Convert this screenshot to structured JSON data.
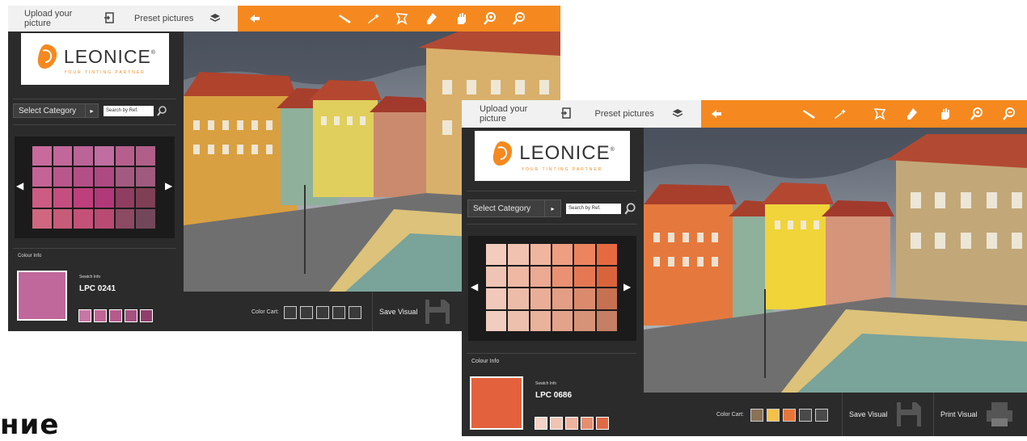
{
  "page": {
    "heading_fragment": "ние"
  },
  "toolbar": {
    "upload_label": "Upload your picture",
    "preset_label": "Preset pictures"
  },
  "brand": {
    "name": "LEONICE",
    "reg": "®",
    "tagline": "YOUR TINTING PARTNER"
  },
  "category": {
    "select_label": "Select Category",
    "search_placeholder": "Search by Ref."
  },
  "colour_info": {
    "section_label": "Colour Info",
    "swatch_info_label": "Swatch Info"
  },
  "bottom": {
    "color_cart_label": "Color Cart:",
    "save_label": "Save Visual",
    "print_label": "Print Visual"
  },
  "window1": {
    "swatch_code": "LPC 0241",
    "selected_color": "#c0679b",
    "palette": [
      [
        "#c86a9c",
        "#c2679a",
        "#bb6497",
        "#c06ea1",
        "#b65f8d",
        "#b05f89"
      ],
      [
        "#c46395",
        "#b9578a",
        "#b44f86",
        "#ad4a82",
        "#a45a80",
        "#9f5a7d"
      ],
      [
        "#cc5c84",
        "#c44e80",
        "#bd3f7b",
        "#b1397a",
        "#8f3e61",
        "#7f4056"
      ],
      [
        "#cf6780",
        "#c65c7a",
        "#c45177",
        "#b94b72",
        "#8c4a63",
        "#73475a"
      ]
    ],
    "mini_swatches": [
      "#c877a5",
      "#c06595",
      "#b55a8c",
      "#a55181",
      "#8e3f6c"
    ],
    "cart": [
      "#3a3a3a",
      "#3a3a3a",
      "#3a3a3a",
      "#3a3a3a",
      "#3a3a3a"
    ]
  },
  "window2": {
    "swatch_code": "LPC 0686",
    "selected_color": "#e4613e",
    "palette": [
      [
        "#f3ccbd",
        "#f1c2b0",
        "#f0b59f",
        "#ee9e81",
        "#ec845f",
        "#e66a40"
      ],
      [
        "#f0c4b4",
        "#eeb8a3",
        "#eca993",
        "#e99172",
        "#e57853",
        "#d9643c"
      ],
      [
        "#f1c9bb",
        "#edbca8",
        "#eaae98",
        "#e39e85",
        "#db8a6d",
        "#c87052"
      ],
      [
        "#f0cdbf",
        "#ecc0ac",
        "#e9b29b",
        "#e3a38a",
        "#d69377",
        "#c47f64"
      ]
    ],
    "mini_swatches": [
      "#f4d2c5",
      "#f0c3b2",
      "#eeb39f",
      "#e68e70",
      "#e06a45"
    ],
    "cart": [
      "#8a7257",
      "#f2c24a",
      "#e8763b",
      "#4a4a4a",
      "#4a4a4a"
    ]
  },
  "colors": {
    "accent": "#f5891f",
    "panel": "#2b2b2b"
  }
}
